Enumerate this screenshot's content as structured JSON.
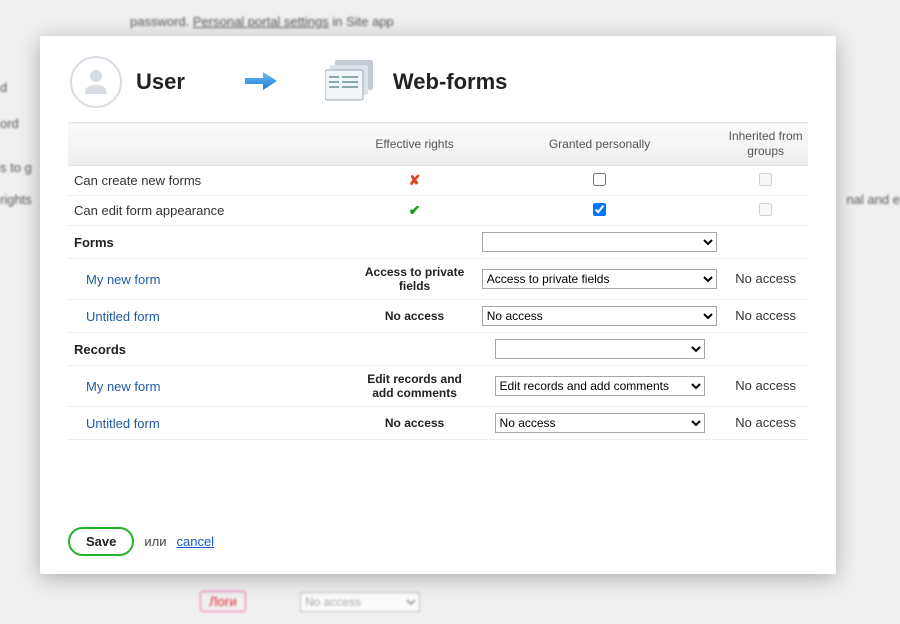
{
  "header": {
    "user_label": "User",
    "target_label": "Web-forms"
  },
  "columns": {
    "c1": "",
    "c2": "Effective rights",
    "c3": "Granted personally",
    "c4": "Inherited from groups"
  },
  "rows": {
    "create": {
      "label": "Can create new forms",
      "granted": false,
      "inherited": false,
      "eff": "cross"
    },
    "edit": {
      "label": "Can edit form appearance",
      "granted": true,
      "inherited": false,
      "eff": "tick"
    }
  },
  "sections": {
    "forms": {
      "title": "Forms",
      "global_select": "",
      "items": [
        {
          "label": "My new form",
          "eff": "Access to private fields",
          "select": "Access to private fields",
          "inh": "No access"
        },
        {
          "label": "Untitled form",
          "eff": "No access",
          "select": "No access",
          "inh": "No access"
        }
      ]
    },
    "records": {
      "title": "Records",
      "global_select": "",
      "items": [
        {
          "label": "My new form",
          "eff": "Edit records and add comments",
          "select": "Edit records and add comments",
          "inh": "No access"
        },
        {
          "label": "Untitled form",
          "eff": "No access",
          "select": "No access",
          "inh": "No access"
        }
      ]
    }
  },
  "footer": {
    "save": "Save",
    "or": "или",
    "cancel": "cancel"
  },
  "background": {
    "link_text": "Personal portal settings",
    "tail": " in Site app",
    "logi": "Логи",
    "bgsel": "No access"
  }
}
